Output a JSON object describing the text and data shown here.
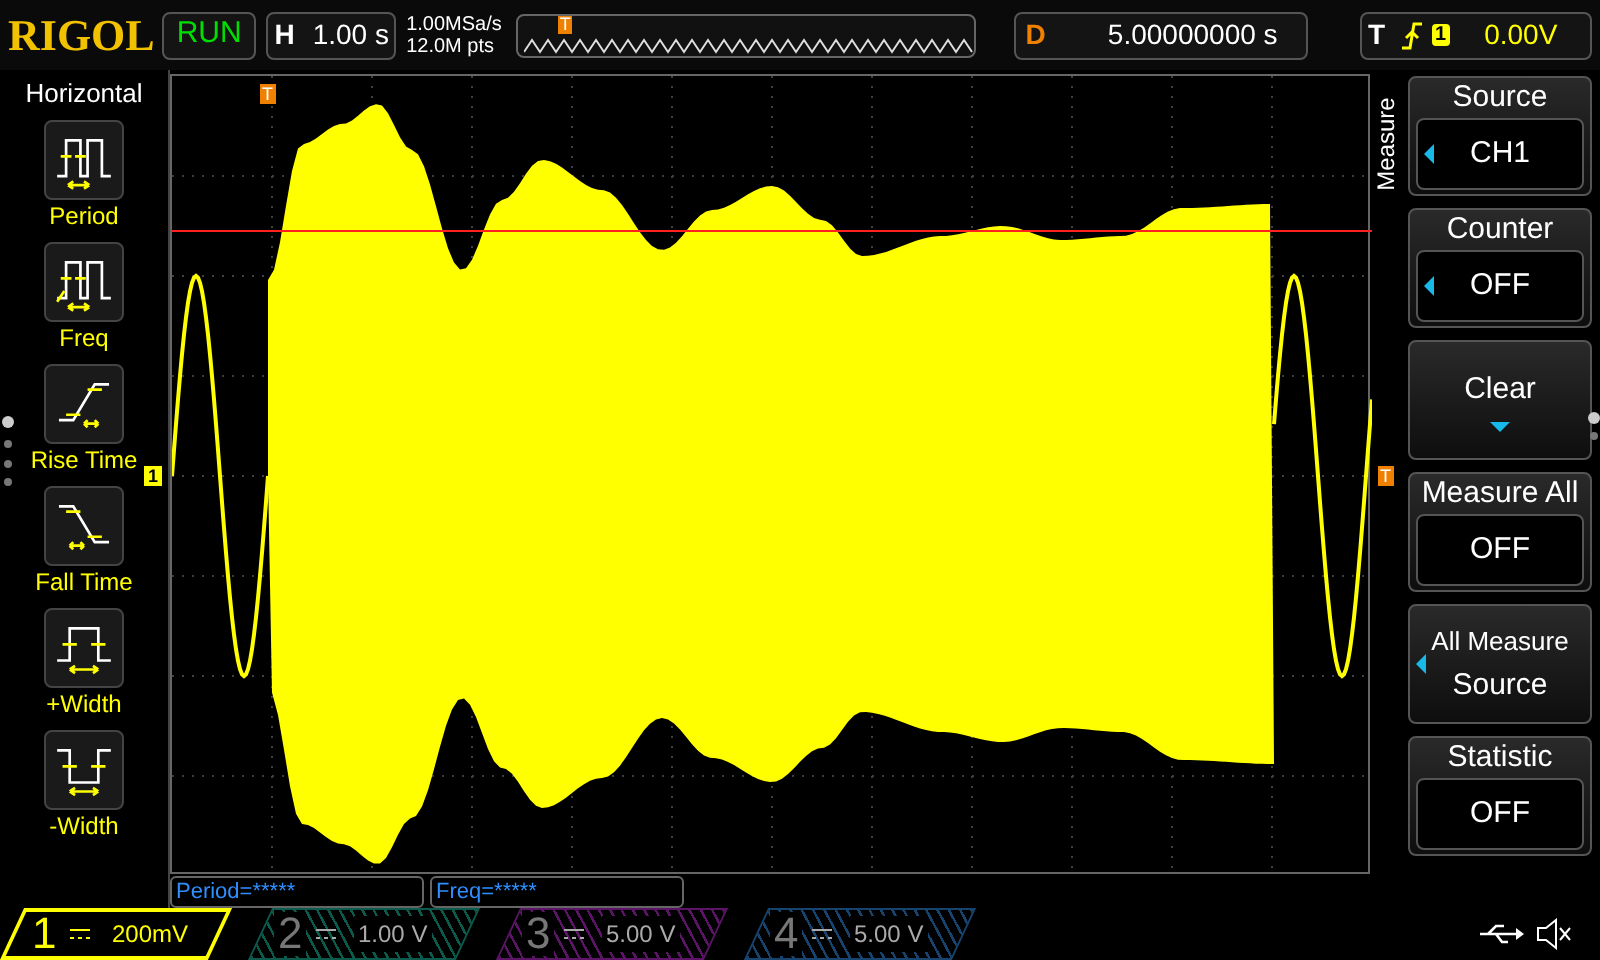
{
  "brand": "RIGOL",
  "run_state": "RUN",
  "timebase": {
    "label": "H",
    "value": "1.00 s"
  },
  "sample_rate": "1.00MSa/s",
  "memory_depth": "12.0M pts",
  "overview_marker": "T",
  "delay": {
    "label": "D",
    "value": "5.00000000 s"
  },
  "trigger": {
    "label": "T",
    "source": "1",
    "level": "0.00V"
  },
  "left_menu": {
    "title": "Horizontal",
    "items": [
      {
        "label": "Period",
        "kind": "period"
      },
      {
        "label": "Freq",
        "kind": "freq"
      },
      {
        "label": "Rise Time",
        "kind": "rise"
      },
      {
        "label": "Fall Time",
        "kind": "fall"
      },
      {
        "label": "+Width",
        "kind": "pwidth"
      },
      {
        "label": "-Width",
        "kind": "nwidth"
      }
    ]
  },
  "plot": {
    "channel_marker": "1",
    "trigger_position_marker": "T",
    "trigger_level_marker": "T"
  },
  "right_menu": {
    "title": "Measure",
    "items": [
      {
        "kind": "value",
        "label": "Source",
        "value": "CH1",
        "has_arrow": true
      },
      {
        "kind": "value",
        "label": "Counter",
        "value": "OFF",
        "has_arrow": true
      },
      {
        "kind": "action",
        "label": "Clear",
        "has_arrow": false
      },
      {
        "kind": "value",
        "label": "Measure All",
        "value": "OFF",
        "has_arrow": false
      },
      {
        "kind": "double",
        "label": "All Measure",
        "value": "Source",
        "has_arrow": true
      },
      {
        "kind": "value",
        "label": "Statistic",
        "value": "OFF",
        "has_arrow": false
      }
    ]
  },
  "measurements": [
    "Period=*****",
    "Freq=*****"
  ],
  "channels": [
    {
      "number": "1",
      "scale": "200mV",
      "selected": true,
      "color": "#ffff00"
    },
    {
      "number": "2",
      "scale": "1.00 V",
      "selected": false,
      "color": "#0b5a4c"
    },
    {
      "number": "3",
      "scale": "5.00 V",
      "selected": false,
      "color": "#5c1466"
    },
    {
      "number": "4",
      "scale": "5.00 V",
      "selected": false,
      "color": "#17446e"
    }
  ]
}
